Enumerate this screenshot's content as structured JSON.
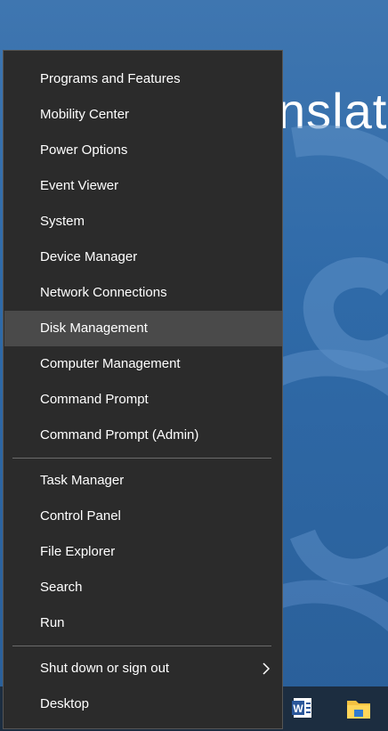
{
  "desktop": {
    "wallpaper_text": "nslato"
  },
  "menu": {
    "group1": [
      {
        "label": "Programs and Features",
        "name": "menu-item-programs-and-features",
        "active": false
      },
      {
        "label": "Mobility Center",
        "name": "menu-item-mobility-center",
        "active": false
      },
      {
        "label": "Power Options",
        "name": "menu-item-power-options",
        "active": false
      },
      {
        "label": "Event Viewer",
        "name": "menu-item-event-viewer",
        "active": false
      },
      {
        "label": "System",
        "name": "menu-item-system",
        "active": false
      },
      {
        "label": "Device Manager",
        "name": "menu-item-device-manager",
        "active": false
      },
      {
        "label": "Network Connections",
        "name": "menu-item-network-connections",
        "active": false
      },
      {
        "label": "Disk Management",
        "name": "menu-item-disk-management",
        "active": true
      },
      {
        "label": "Computer Management",
        "name": "menu-item-computer-management",
        "active": false
      },
      {
        "label": "Command Prompt",
        "name": "menu-item-command-prompt",
        "active": false
      },
      {
        "label": "Command Prompt (Admin)",
        "name": "menu-item-command-prompt-admin",
        "active": false
      }
    ],
    "group2": [
      {
        "label": "Task Manager",
        "name": "menu-item-task-manager",
        "active": false
      },
      {
        "label": "Control Panel",
        "name": "menu-item-control-panel",
        "active": false
      },
      {
        "label": "File Explorer",
        "name": "menu-item-file-explorer",
        "active": false
      },
      {
        "label": "Search",
        "name": "menu-item-search",
        "active": false
      },
      {
        "label": "Run",
        "name": "menu-item-run",
        "active": false
      }
    ],
    "group3": [
      {
        "label": "Shut down or sign out",
        "name": "menu-item-shut-down-or-sign-out",
        "active": false,
        "has_submenu": true
      },
      {
        "label": "Desktop",
        "name": "menu-item-desktop",
        "active": false
      }
    ]
  },
  "taskbar": {
    "icons": [
      "word-icon",
      "file-explorer-icon"
    ]
  },
  "colors": {
    "menu_bg": "#2b2b2b",
    "menu_hover": "#4a4a4a",
    "menu_text": "#ffffff",
    "wallpaper": "#2f6aa8",
    "taskbar": "#1c2d40"
  }
}
